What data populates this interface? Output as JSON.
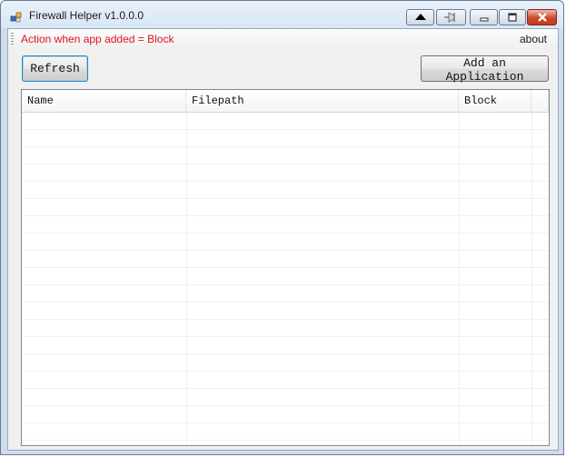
{
  "window": {
    "title": "Firewall Helper v1.0.0.0",
    "icons": [
      "app-icon",
      "up-arrow-icon",
      "pin-icon",
      "minimize-icon",
      "maximize-icon",
      "close-icon"
    ]
  },
  "menubar": {
    "action_text": "Action when app added = Block",
    "action_color": "#e0141e",
    "about_label": "about"
  },
  "toolbar": {
    "refresh_label": "Refresh",
    "add_label": "Add an Application"
  },
  "grid": {
    "columns": [
      {
        "label": "Name"
      },
      {
        "label": "Filepath"
      },
      {
        "label": "Block"
      },
      {
        "label": ""
      }
    ],
    "rows": []
  }
}
